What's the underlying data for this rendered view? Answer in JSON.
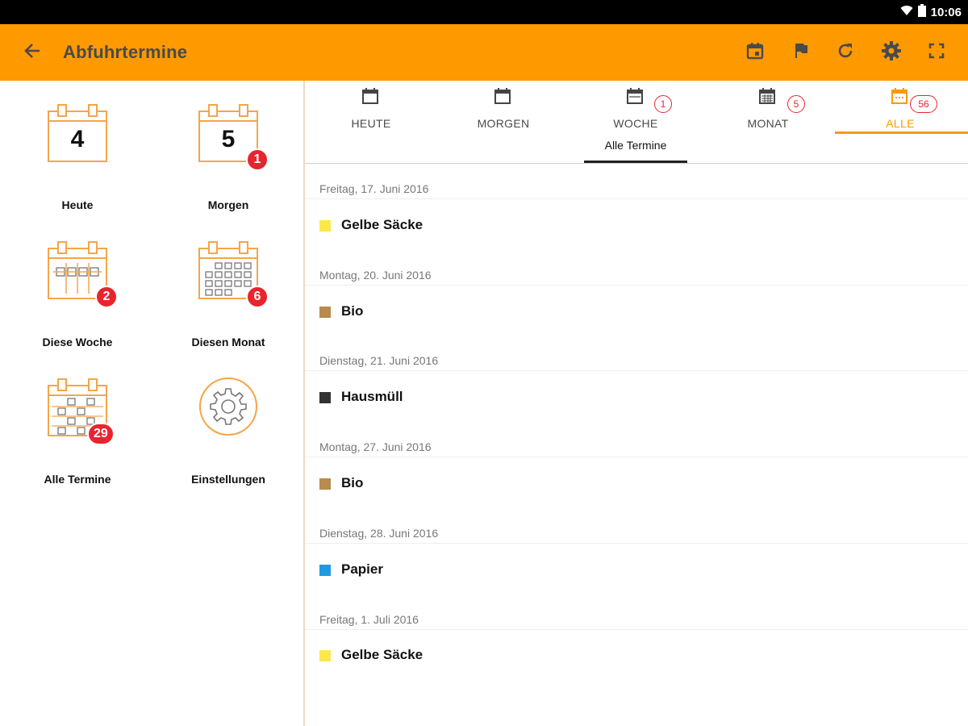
{
  "status_bar": {
    "time": "10:06"
  },
  "app_bar": {
    "title": "Abfuhrtermine"
  },
  "dashboard": [
    {
      "label": "Heute",
      "day": "4",
      "badge": ""
    },
    {
      "label": "Morgen",
      "day": "5",
      "badge": "1"
    },
    {
      "label": "Diese Woche",
      "badge": "2"
    },
    {
      "label": "Diesen Monat",
      "badge": "6"
    },
    {
      "label": "Alle Termine",
      "badge": "29"
    },
    {
      "label": "Einstellungen"
    }
  ],
  "tabs": [
    {
      "label": "HEUTE",
      "badge": ""
    },
    {
      "label": "MORGEN",
      "badge": ""
    },
    {
      "label": "WOCHE",
      "badge": "1"
    },
    {
      "label": "MONAT",
      "badge": "5"
    },
    {
      "label": "ALLE",
      "badge": "56"
    }
  ],
  "subtab": {
    "label": "Alle Termine"
  },
  "entries": [
    {
      "date": "Freitag, 17. Juni 2016",
      "label": "Gelbe Säcke",
      "color": "#fde84a"
    },
    {
      "date": "Montag, 20. Juni 2016",
      "label": "Bio",
      "color": "#b88a4d"
    },
    {
      "date": "Dienstag, 21. Juni 2016",
      "label": "Hausmüll",
      "color": "#333333"
    },
    {
      "date": "Montag, 27. Juni 2016",
      "label": "Bio",
      "color": "#b88a4d"
    },
    {
      "date": "Dienstag, 28. Juni 2016",
      "label": "Papier",
      "color": "#1e9be0"
    },
    {
      "date": "Freitag, 1. Juli 2016",
      "label": "Gelbe Säcke",
      "color": "#fde84a"
    }
  ],
  "colors": {
    "accent": "#ff9900",
    "badge": "#e8242e"
  },
  "icons": [
    "arrow-back-icon",
    "calendar-today-icon",
    "flag-icon",
    "refresh-icon",
    "settings-icon",
    "fullscreen-icon",
    "wifi-icon",
    "battery-icon"
  ]
}
